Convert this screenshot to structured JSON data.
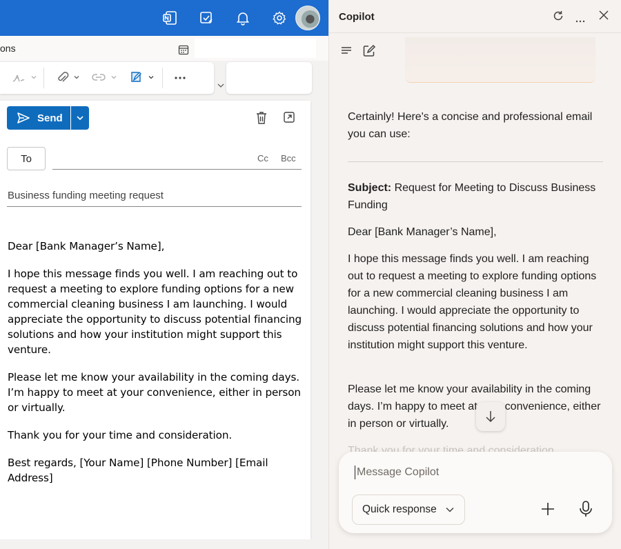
{
  "outlook": {
    "ribbon_partial_label": "ons",
    "send_label": "Send",
    "to_label": "To",
    "cc_label": "Cc",
    "bcc_label": "Bcc",
    "subject": "Business funding meeting request",
    "body": [
      "Dear [Bank Manager’s Name],",
      "I hope this message finds you well. I am reaching out to request a meeting to explore funding options for a new commercial cleaning business I am launching. I would appreciate the opportunity to discuss potential financing solutions and how your institution might support this venture.",
      "Please let me know your availability in the coming days. I’m happy to meet at your convenience, either in person or virtually.",
      "Thank you for your time and consideration.",
      "Best regards, [Your Name] [Phone Number] [Email Address]"
    ]
  },
  "copilot": {
    "title": "Copilot",
    "intro": "Certainly! Here's a concise and professional email you can use:",
    "subject_label": "Subject:",
    "subject_text": "Request for Meeting to Discuss Business Funding",
    "greeting": "Dear [Bank Manager’s Name],",
    "para1": "I hope this message finds you well. I am reaching out to request a meeting to explore funding options for a new commercial cleaning business I am launching. I would appreciate the opportunity to discuss potential financing solutions and how your institution might support this venture.",
    "para2": "Please let me know your availability in the coming days. I’m happy to meet at your convenience, either in person or virtually.",
    "para3_faded": "Thank you for your time and consideration.",
    "input_placeholder": "Message Copilot",
    "quick_response_label": "Quick response"
  },
  "colors": {
    "outlook_blue": "#1d6ccf",
    "send_blue": "#0f6cbd",
    "copilot_bg": "#f6f2ef"
  },
  "icons": [
    "onenote-icon",
    "todo-icon",
    "bell-icon",
    "gear-icon",
    "avatar",
    "calendar-icon",
    "format-painter-icon",
    "attach-icon",
    "link-icon",
    "signature-icon",
    "more-icon",
    "send-icon",
    "chevron-down-icon",
    "trash-icon",
    "popout-icon",
    "refresh-icon",
    "close-icon",
    "menu-icon",
    "new-chat-icon",
    "arrow-down-icon",
    "plus-icon",
    "mic-icon"
  ]
}
